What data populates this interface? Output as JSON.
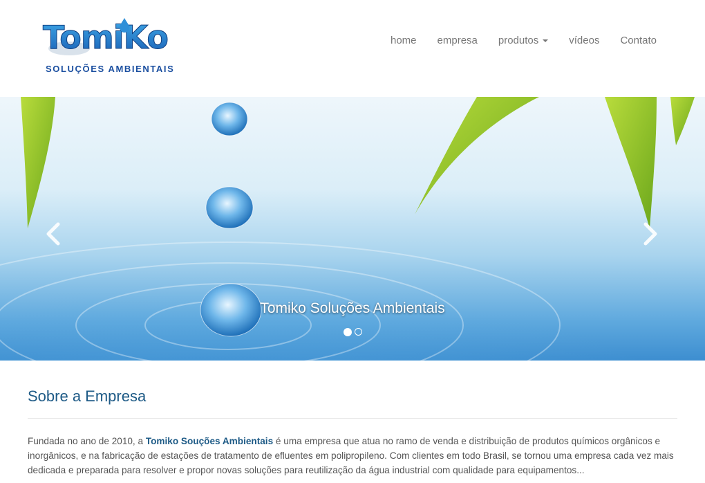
{
  "brand": {
    "logo_text": "TomiKo",
    "tagline": "SOLUÇÕES AMBIENTAIS"
  },
  "nav": {
    "items": [
      "home",
      "empresa",
      "produtos",
      "vídeos",
      "Contato"
    ]
  },
  "carousel": {
    "caption": "Tomiko Soluções Ambientais",
    "slide_count": 2,
    "active_slide": 1
  },
  "about": {
    "title": "Sobre a Empresa",
    "intro": "Fundada no ano de 2010, a ",
    "company": "Tomiko Souções Ambientais",
    "body": " é uma empresa que atua no ramo de venda e distribuição de produtos químicos orgânicos e inorgânicos, e na fabricação de estações de tratamento de efluentes em polipropileno. Com clientes em todo Brasil, se tornou uma empresa cada vez mais dedicada e preparada para resolver e propor novas soluções para reutilização da água industrial com qualidade para equipamentos..."
  },
  "colors": {
    "accent": "#1d5a86",
    "nav_text": "#777777",
    "logo_blue": "#1b4fa0"
  },
  "icons": [
    "droplet-icon",
    "chevron-left-icon",
    "chevron-right-icon",
    "caret-down-icon"
  ]
}
